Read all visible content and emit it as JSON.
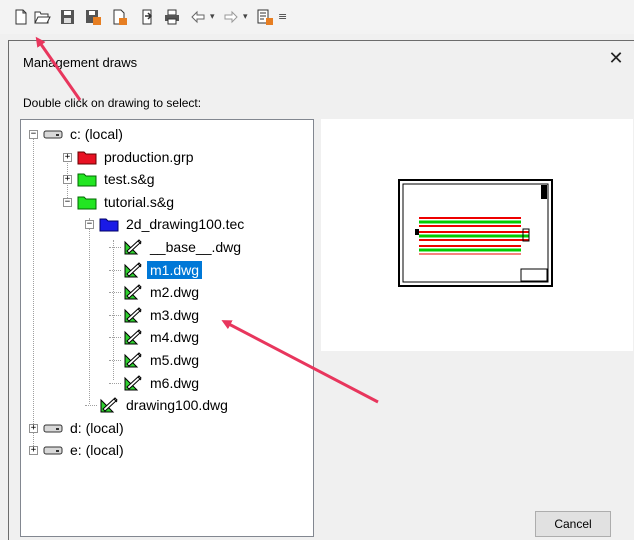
{
  "toolbar": {
    "icons": [
      "new-icon",
      "open-icon",
      "save-icon",
      "save-as-icon",
      "import-icon",
      "export-icon",
      "print-icon",
      "undo-icon",
      "redo-icon",
      "settings-icon"
    ]
  },
  "dialog": {
    "title": "Management draws",
    "close_glyph": "✕",
    "instruction": "Double click on drawing to select:",
    "cancel_label": "Cancel"
  },
  "tree": [
    {
      "label": "c: (local)",
      "icon": "drive-icon",
      "depth": 0,
      "expander": "−"
    },
    {
      "label": "production.grp",
      "icon": "folder-red-icon",
      "depth": 1,
      "expander": "+"
    },
    {
      "label": "test.s&g",
      "icon": "folder-green-icon",
      "depth": 1,
      "expander": "+"
    },
    {
      "label": "tutorial.s&g",
      "icon": "folder-green-icon",
      "depth": 1,
      "expander": "−"
    },
    {
      "label": "2d_drawing100.tec",
      "icon": "folder-blue-icon",
      "depth": 2,
      "expander": "−"
    },
    {
      "label": "__base__.dwg",
      "icon": "drawing-icon",
      "depth": 3
    },
    {
      "label": "m1.dwg",
      "icon": "drawing-icon",
      "depth": 3,
      "selected": true
    },
    {
      "label": "m2.dwg",
      "icon": "drawing-icon",
      "depth": 3
    },
    {
      "label": "m3.dwg",
      "icon": "drawing-icon",
      "depth": 3
    },
    {
      "label": "m4.dwg",
      "icon": "drawing-icon",
      "depth": 3
    },
    {
      "label": "m5.dwg",
      "icon": "drawing-icon",
      "depth": 3
    },
    {
      "label": "m6.dwg",
      "icon": "drawing-icon",
      "depth": 3
    },
    {
      "label": "drawing100.dwg",
      "icon": "drawing-icon",
      "depth": 2
    },
    {
      "label": "d: (local)",
      "icon": "drive-icon",
      "depth": 0,
      "expander": "+"
    },
    {
      "label": "e: (local)",
      "icon": "drive-icon",
      "depth": 0,
      "expander": "+"
    }
  ],
  "colors": {
    "selection": "#0078d7",
    "annotation_arrow": "#e8365d",
    "folder_red": "#e81123",
    "folder_green": "#22e622",
    "folder_blue": "#1a1ae6"
  }
}
